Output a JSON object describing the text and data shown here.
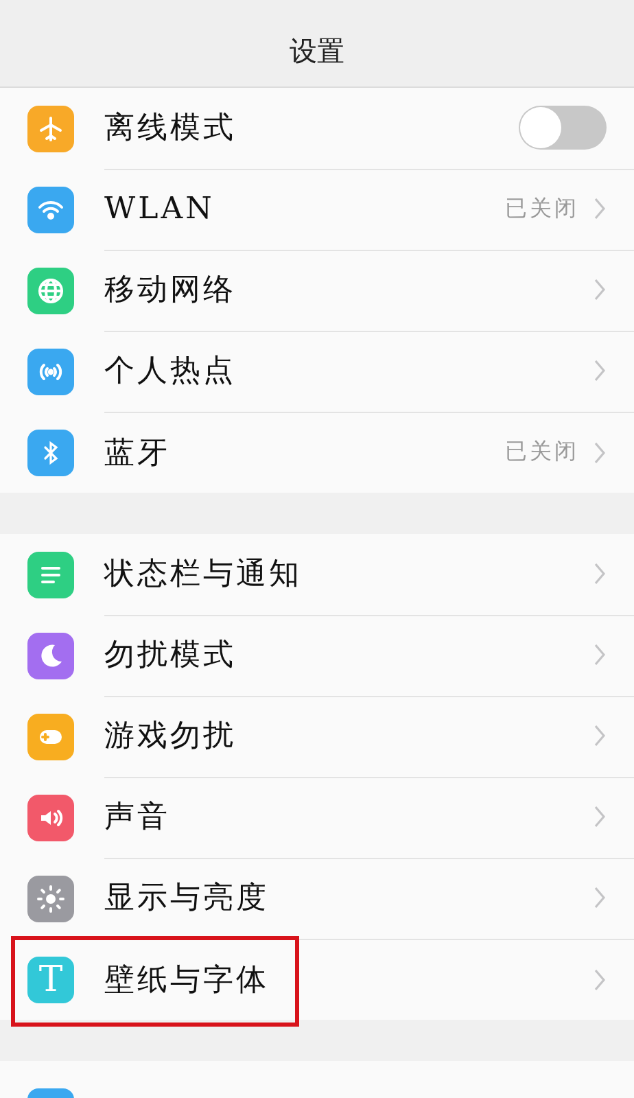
{
  "header": {
    "title": "设置"
  },
  "groups": [
    {
      "items": [
        {
          "kind": "toggle",
          "label": "离线模式",
          "on": false
        },
        {
          "kind": "link",
          "label": "WLAN",
          "value": "已关闭"
        },
        {
          "kind": "link",
          "label": "移动网络"
        },
        {
          "kind": "link",
          "label": "个人热点"
        },
        {
          "kind": "link",
          "label": "蓝牙",
          "value": "已关闭"
        }
      ]
    },
    {
      "items": [
        {
          "kind": "link",
          "label": "状态栏与通知"
        },
        {
          "kind": "link",
          "label": "勿扰模式"
        },
        {
          "kind": "link",
          "label": "游戏勿扰"
        },
        {
          "kind": "link",
          "label": "声音"
        },
        {
          "kind": "link",
          "label": "显示与亮度"
        },
        {
          "kind": "link",
          "label": "壁纸与字体",
          "glyph": "T",
          "highlighted": true
        }
      ]
    }
  ]
}
